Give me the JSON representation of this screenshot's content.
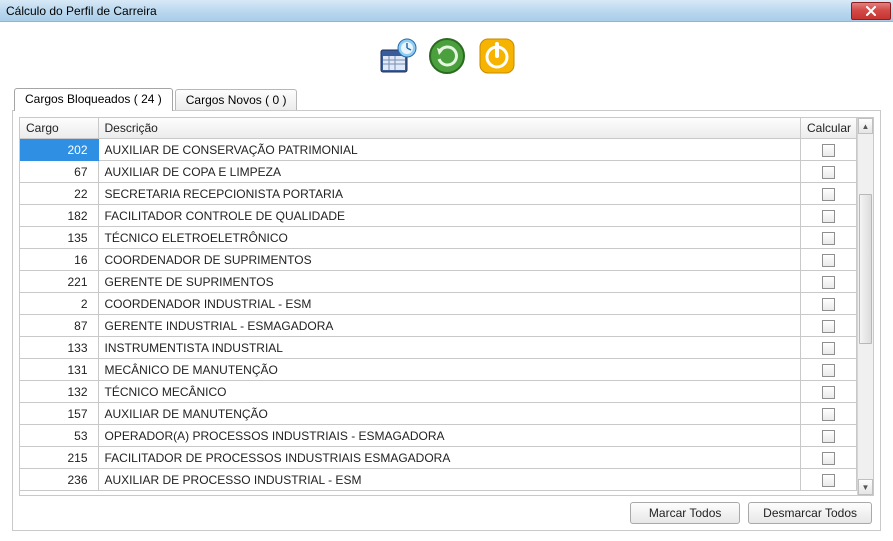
{
  "window": {
    "title": "Cálculo do Perfil de Carreira"
  },
  "toolbar": {
    "icon1": "calendar-clock-icon",
    "icon2": "refresh-icon",
    "icon3": "power-icon"
  },
  "tabs": [
    {
      "label": "Cargos Bloqueados ( 24 )",
      "active": true
    },
    {
      "label": "Cargos Novos ( 0 )",
      "active": false
    }
  ],
  "grid": {
    "columns": {
      "cargo": "Cargo",
      "descricao": "Descrição",
      "calcular": "Calcular"
    },
    "rows": [
      {
        "cargo": "202",
        "descricao": "AUXILIAR DE CONSERVAÇÃO PATRIMONIAL",
        "calcular": false,
        "selected": true
      },
      {
        "cargo": "67",
        "descricao": "AUXILIAR DE COPA E LIMPEZA",
        "calcular": false
      },
      {
        "cargo": "22",
        "descricao": "SECRETARIA RECEPCIONISTA PORTARIA",
        "calcular": false
      },
      {
        "cargo": "182",
        "descricao": "FACILITADOR CONTROLE DE QUALIDADE",
        "calcular": false
      },
      {
        "cargo": "135",
        "descricao": "TÉCNICO ELETROELETRÔNICO",
        "calcular": false
      },
      {
        "cargo": "16",
        "descricao": "COORDENADOR DE SUPRIMENTOS",
        "calcular": false
      },
      {
        "cargo": "221",
        "descricao": "GERENTE DE SUPRIMENTOS",
        "calcular": false
      },
      {
        "cargo": "2",
        "descricao": "COORDENADOR INDUSTRIAL - ESM",
        "calcular": false
      },
      {
        "cargo": "87",
        "descricao": "GERENTE INDUSTRIAL - ESMAGADORA",
        "calcular": false
      },
      {
        "cargo": "133",
        "descricao": "INSTRUMENTISTA INDUSTRIAL",
        "calcular": false
      },
      {
        "cargo": "131",
        "descricao": "MECÂNICO DE MANUTENÇÃO",
        "calcular": false
      },
      {
        "cargo": "132",
        "descricao": "TÉCNICO MECÂNICO",
        "calcular": false
      },
      {
        "cargo": "157",
        "descricao": "AUXILIAR DE MANUTENÇÃO",
        "calcular": false
      },
      {
        "cargo": "53",
        "descricao": "OPERADOR(A) PROCESSOS INDUSTRIAIS - ESMAGADORA",
        "calcular": false
      },
      {
        "cargo": "215",
        "descricao": "FACILITADOR DE PROCESSOS INDUSTRIAIS ESMAGADORA",
        "calcular": false
      },
      {
        "cargo": "236",
        "descricao": "AUXILIAR DE PROCESSO INDUSTRIAL - ESM",
        "calcular": false
      }
    ]
  },
  "buttons": {
    "marcar_todos": "Marcar Todos",
    "desmarcar_todos": "Desmarcar Todos"
  }
}
